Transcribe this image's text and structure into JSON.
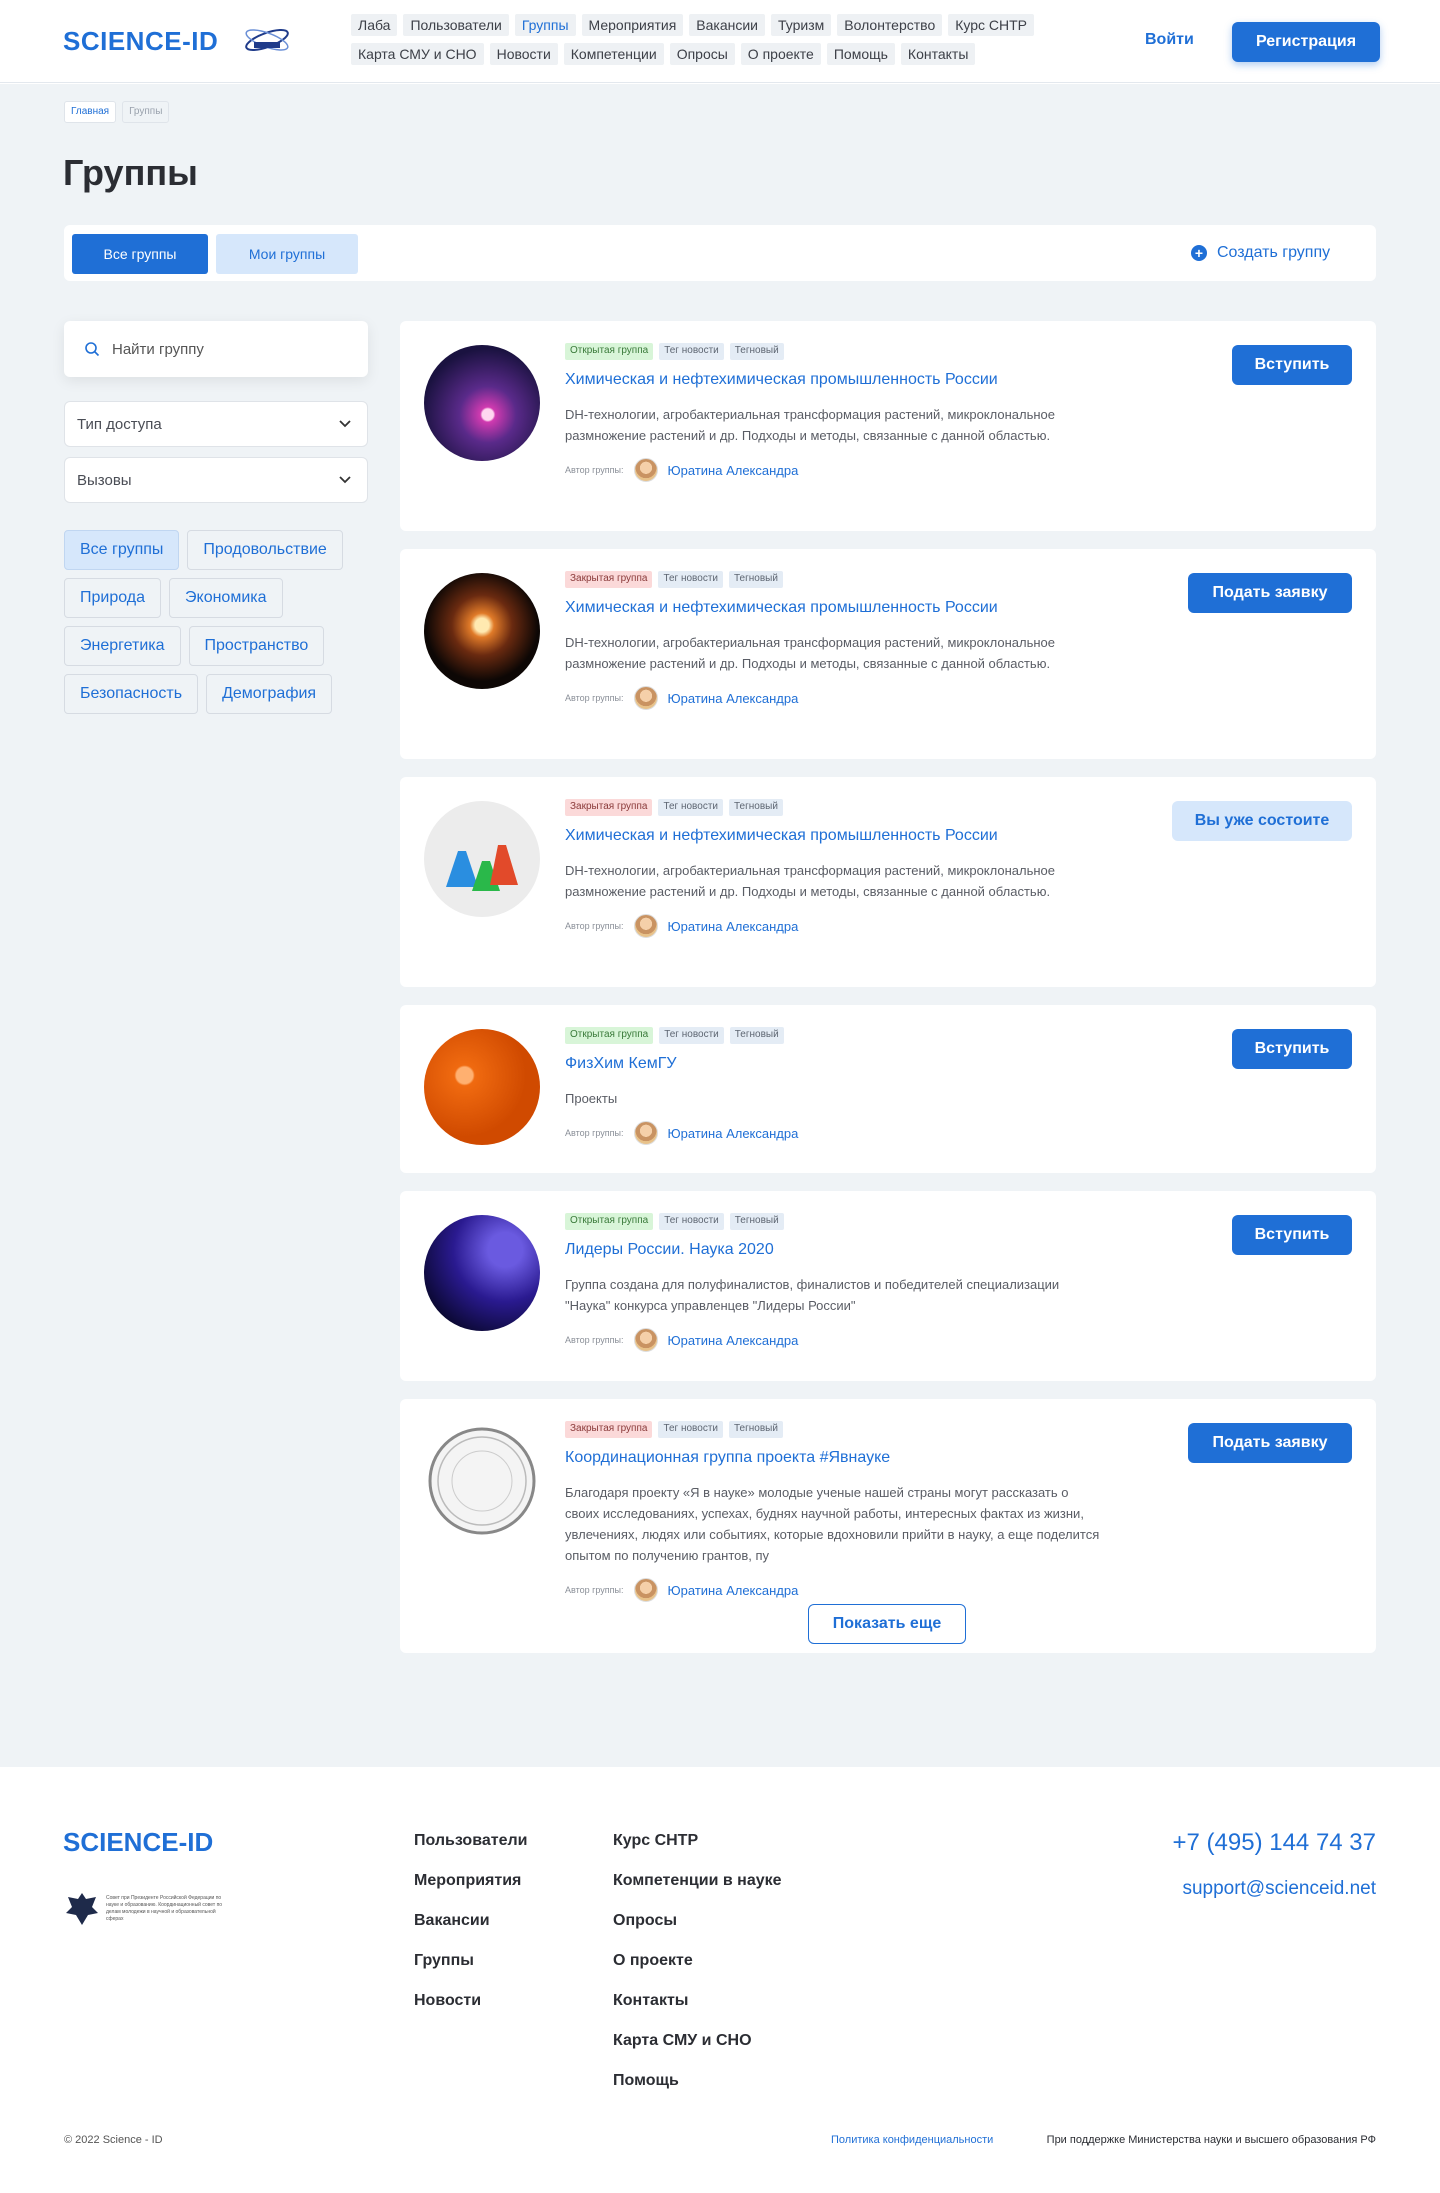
{
  "header": {
    "logo": "SCIENCE-ID",
    "nav": [
      "Лаба",
      "Пользователи",
      "Группы",
      "Мероприятия",
      "Вакансии",
      "Туризм",
      "Волонтерство",
      "Курс СНТР",
      "Карта СМУ и СНО",
      "Новости",
      "Компетенции",
      "Опросы",
      "О проекте",
      "Помощь",
      "Контакты"
    ],
    "nav_active": "Группы",
    "login": "Войти",
    "register": "Регистрация"
  },
  "breadcrumb": {
    "home": "Главная",
    "current": "Группы"
  },
  "page_title": "Группы",
  "tabs": {
    "all": "Все группы",
    "mine": "Мои группы",
    "create": "Создать группу"
  },
  "sidebar": {
    "search_placeholder": "Найти группу",
    "access_select": "Тип доступа",
    "challenges_select": "Вызовы",
    "chips": [
      "Все группы",
      "Продовольствие",
      "Природа",
      "Экономика",
      "Энергетика",
      "Пространство",
      "Безопасность",
      "Демография"
    ]
  },
  "author_label": "Автор группы:",
  "tag_news": "Тег новости",
  "tag_tech": "Тегновый",
  "groups": [
    {
      "access": "Открытая группа",
      "title": "Химическая и нефтехимическая промышленность России",
      "desc": "DH-технологии, агробактериальная трансформация растений, микроклональное размножение растений и др. Подходы и методы, связанные с данной областью.",
      "author": "Юратина Александра",
      "button": "Вступить"
    },
    {
      "access": "Закрытая группа",
      "title": "Химическая и нефтехимическая промышленность России",
      "desc": "DH-технологии, агробактериальная трансформация растений, микроклональное размножение растений и др. Подходы и методы, связанные с данной областью.",
      "author": "Юратина Александра",
      "button": "Подать заявку"
    },
    {
      "access": "Закрытая группа",
      "title": "Химическая и нефтехимическая промышленность России",
      "desc": "DH-технологии, агробактериальная трансформация растений, микроклональное размножение растений и др. Подходы и методы, связанные с данной областью.",
      "author": "Юратина Александра",
      "button": "Вы уже состоите"
    },
    {
      "access": "Открытая группа",
      "title": "ФизХим КемГУ",
      "desc": "Проекты",
      "author": "Юратина Александра",
      "button": "Вступить"
    },
    {
      "access": "Открытая группа",
      "title": "Лидеры России. Наука 2020",
      "desc": "Группа создана для полуфиналистов, финалистов и победителей специализации \"Наука\" конкурса управленцев \"Лидеры России\"",
      "author": "Юратина Александра",
      "button": "Вступить"
    },
    {
      "access": "Закрытая группа",
      "title": "Координационная группа проекта #Явнауке",
      "desc": "Благодаря проекту «Я в науке» молодые ученые нашей страны могут рассказать о своих исследованиях, успехах, буднях научной работы, интересных фактах из жизни, увлечениях, людях или событиях, которые вдохновили прийти в науку, а еще поделится опытом по получению грантов, пу",
      "author": "Юратина Александра",
      "button": "Подать заявку"
    }
  ],
  "show_more": "Показать еще",
  "footer": {
    "logo": "SCIENCE-ID",
    "emblem_text": "Совет при Президенте Российской Федерации по науке и образованию. Координационный совет по делам молодежи в научной и образовательной сферах",
    "col1": [
      "Пользователи",
      "Мероприятия",
      "Вакансии",
      "Группы",
      "Новости"
    ],
    "col2": [
      "Курс СНТР",
      "Компетенции в науке",
      "Опросы",
      "О проекте",
      "Контакты",
      "Карта СМУ и СНО",
      "Помощь"
    ],
    "phone": "+7 (495) 144 74 37",
    "email": "support@scienceid.net",
    "copyright": "© 2022 Science - ID",
    "policy": "Политика конфиденциальности",
    "support": "При поддержке Министерства науки и высшего образования РФ"
  }
}
